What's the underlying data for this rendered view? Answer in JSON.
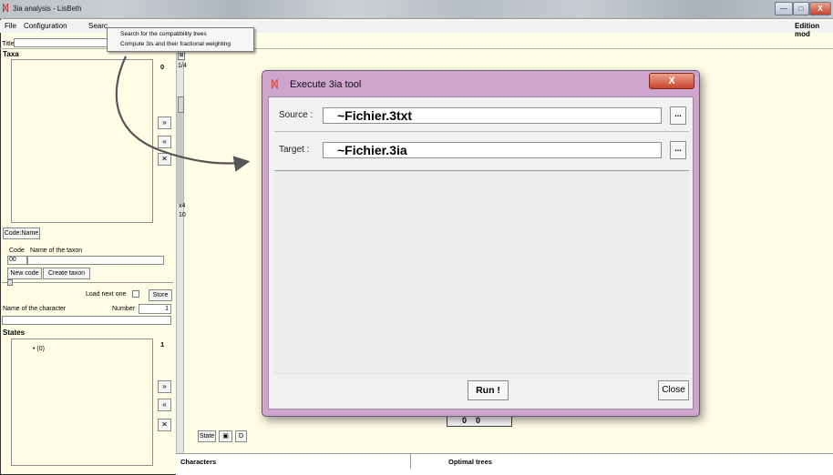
{
  "window": {
    "title": "3ia analysis - LisBeth",
    "edition_mode": "Edition mod",
    "buttons": {
      "minimize": "—",
      "maximize": "□",
      "close": "X"
    }
  },
  "menubar": {
    "items": [
      "File",
      "Configuration",
      "Searc"
    ]
  },
  "dropdown": {
    "items": [
      "Search for the compatibility trees",
      "Compute 3is and their fractional weighting"
    ]
  },
  "title_row": {
    "label": "Title :",
    "value": ""
  },
  "taxa": {
    "title": "Taxa",
    "count": "0",
    "move_right": "»",
    "move_left": "«",
    "remove": "✕",
    "code_name_button": "Code:Name",
    "code_label": "Code",
    "name_label": "Name of the taxon",
    "code_value": "00",
    "name_value": "",
    "new_code_button": "New code",
    "create_taxon_button": "Create taxon"
  },
  "character": {
    "load_next_label": "Load next one",
    "load_next_checked": false,
    "store_button": "Store",
    "name_label": "Name of the character",
    "number_label": "Number",
    "number_value": "1",
    "name_value": ""
  },
  "states": {
    "title": "States",
    "count": "1",
    "items": [
      "• (0)"
    ],
    "move_right": "»",
    "move_left": "«",
    "remove": "✕"
  },
  "zoom": {
    "top_value": "1/4",
    "mark": "x4",
    "bottom_value": "10"
  },
  "toolbar_bottom": {
    "state_button": "State",
    "d_button": "D"
  },
  "bottom_panels": {
    "characters": "Characters",
    "optimal_trees": "Optimal trees"
  },
  "behind": {
    "text": "0    0"
  },
  "dialog": {
    "title": "Execute 3ia tool",
    "close_label": "X",
    "source_label": "Source :",
    "source_value": "~Fichier.3txt",
    "target_label": "Target :",
    "target_value": "~Fichier.3ia",
    "browse_label": "...",
    "run_button": "Run !",
    "close_button": "Close"
  }
}
